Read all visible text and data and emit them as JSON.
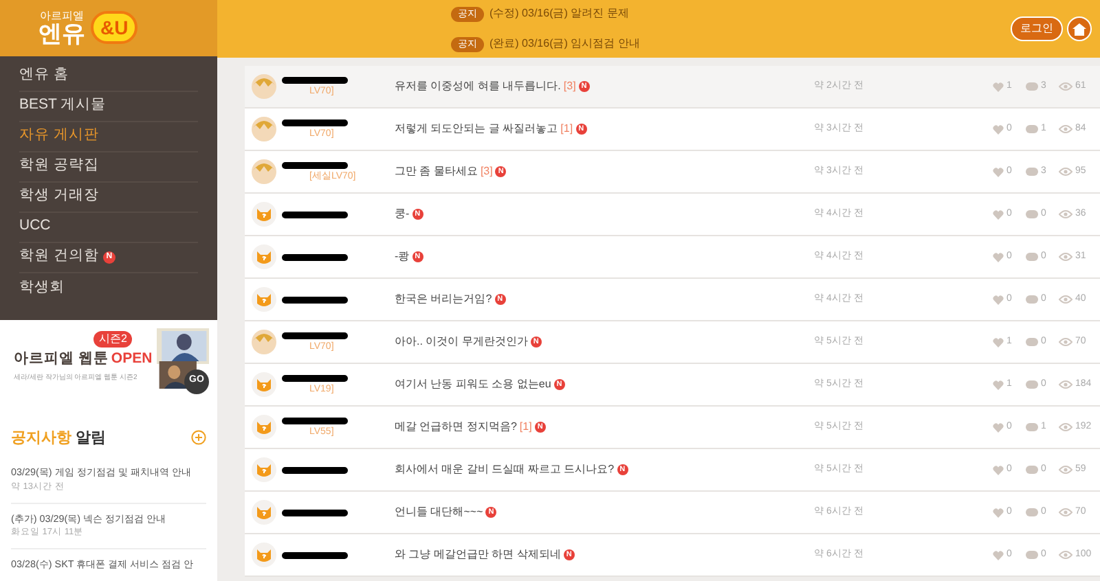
{
  "logo": {
    "small": "아르피엘",
    "big": "엔유",
    "badge": "&U"
  },
  "header_notices": [
    {
      "tag": "공지",
      "text": "(수정) 03/16(금) 알려진 문제"
    },
    {
      "tag": "공지",
      "text": "(완료) 03/16(금) 임시점검 안내"
    }
  ],
  "header_buttons": {
    "login": "로그인"
  },
  "menu": [
    {
      "label": "엔유 홈",
      "selected": false
    },
    {
      "label": "BEST 게시물",
      "selected": false
    },
    {
      "label": "자유 게시판",
      "selected": true
    },
    {
      "label": "학원 공략집",
      "selected": false
    },
    {
      "label": "학생 거래장",
      "selected": false
    },
    {
      "label": "UCC",
      "selected": false
    },
    {
      "label": "학원 건의함",
      "selected": false,
      "badge": "N"
    },
    {
      "label": "학생회",
      "selected": false
    }
  ],
  "banner": {
    "season": "시즌2",
    "title": "아르피엘 웹툰",
    "open": "OPEN",
    "subtitle": "세라/세란 작가님의 아르피엘 웹툰 시즌2",
    "go": "GO"
  },
  "notices": {
    "title": "공지사항",
    "title2": "알림",
    "items": [
      {
        "text": "03/29(목) 게임 정기점검 및 패치내역 안내",
        "time": "약 13시간 전"
      },
      {
        "text": "(추가) 03/29(목) 넥슨 정기점검 안내",
        "time": "화요일 17시 11분"
      },
      {
        "text": "03/28(수) SKT 휴대폰 결제 서비스 점검 안"
      }
    ]
  },
  "posts": [
    {
      "kind": "character",
      "level": "LV70]",
      "title": "유저를 이중성에 혀를 내두릅니다.",
      "comments": "[3]",
      "badge": "N",
      "time": "약 2시간 전",
      "likes": "1",
      "replies": "3",
      "views": "61",
      "selected": true
    },
    {
      "kind": "character",
      "level": "LV70]",
      "title": "저렇게 되도안되는 글 싸질러놓고",
      "comments": "[1]",
      "badge": "N",
      "time": "약 3시간 전",
      "likes": "0",
      "replies": "1",
      "views": "84",
      "selected": false
    },
    {
      "kind": "character",
      "level": "[세실LV70]",
      "title": "그만 좀 물타세요",
      "comments": "[3]",
      "badge": "N",
      "time": "약 3시간 전",
      "likes": "0",
      "replies": "3",
      "views": "95",
      "selected": false
    },
    {
      "kind": "cat",
      "title": "쿵-",
      "badge": "N",
      "time": "약 4시간 전",
      "likes": "0",
      "replies": "0",
      "views": "36",
      "selected": false
    },
    {
      "kind": "cat",
      "title": "-쾅",
      "badge": "N",
      "time": "약 4시간 전",
      "likes": "0",
      "replies": "0",
      "views": "31",
      "selected": false
    },
    {
      "kind": "cat",
      "title": "한국은 버리는거임?",
      "badge": "N",
      "time": "약 4시간 전",
      "likes": "0",
      "replies": "0",
      "views": "40",
      "selected": false
    },
    {
      "kind": "character",
      "level": "LV70]",
      "title": "아아.. 이것이 무게란것인가",
      "badge": "N",
      "time": "약 5시간 전",
      "likes": "1",
      "replies": "0",
      "views": "70",
      "selected": false
    },
    {
      "kind": "cat",
      "level": "LV19]",
      "title": "여기서 난동 피워도 소용 없는eu",
      "badge": "N",
      "time": "약 5시간 전",
      "likes": "1",
      "replies": "0",
      "views": "184",
      "selected": false
    },
    {
      "kind": "cat",
      "level": "LV55]",
      "title": "메갈 언급하면 정지먹음?",
      "comments": "[1]",
      "badge": "N",
      "time": "약 5시간 전",
      "likes": "0",
      "replies": "1",
      "views": "192",
      "selected": false
    },
    {
      "kind": "cat",
      "title": "회사에서 매운 갈비 드실때 짜르고 드시나요?",
      "badge": "N",
      "time": "약 5시간 전",
      "likes": "0",
      "replies": "0",
      "views": "59",
      "selected": false
    },
    {
      "kind": "cat",
      "title": "언니들 대단해~~~",
      "badge": "N",
      "time": "약 6시간 전",
      "likes": "0",
      "replies": "0",
      "views": "70",
      "selected": false
    },
    {
      "kind": "cat",
      "title": "와 그냥 메갈언급만 하면 삭제되네",
      "badge": "N",
      "time": "약 6시간 전",
      "likes": "0",
      "replies": "0",
      "views": "100",
      "selected": false
    }
  ]
}
